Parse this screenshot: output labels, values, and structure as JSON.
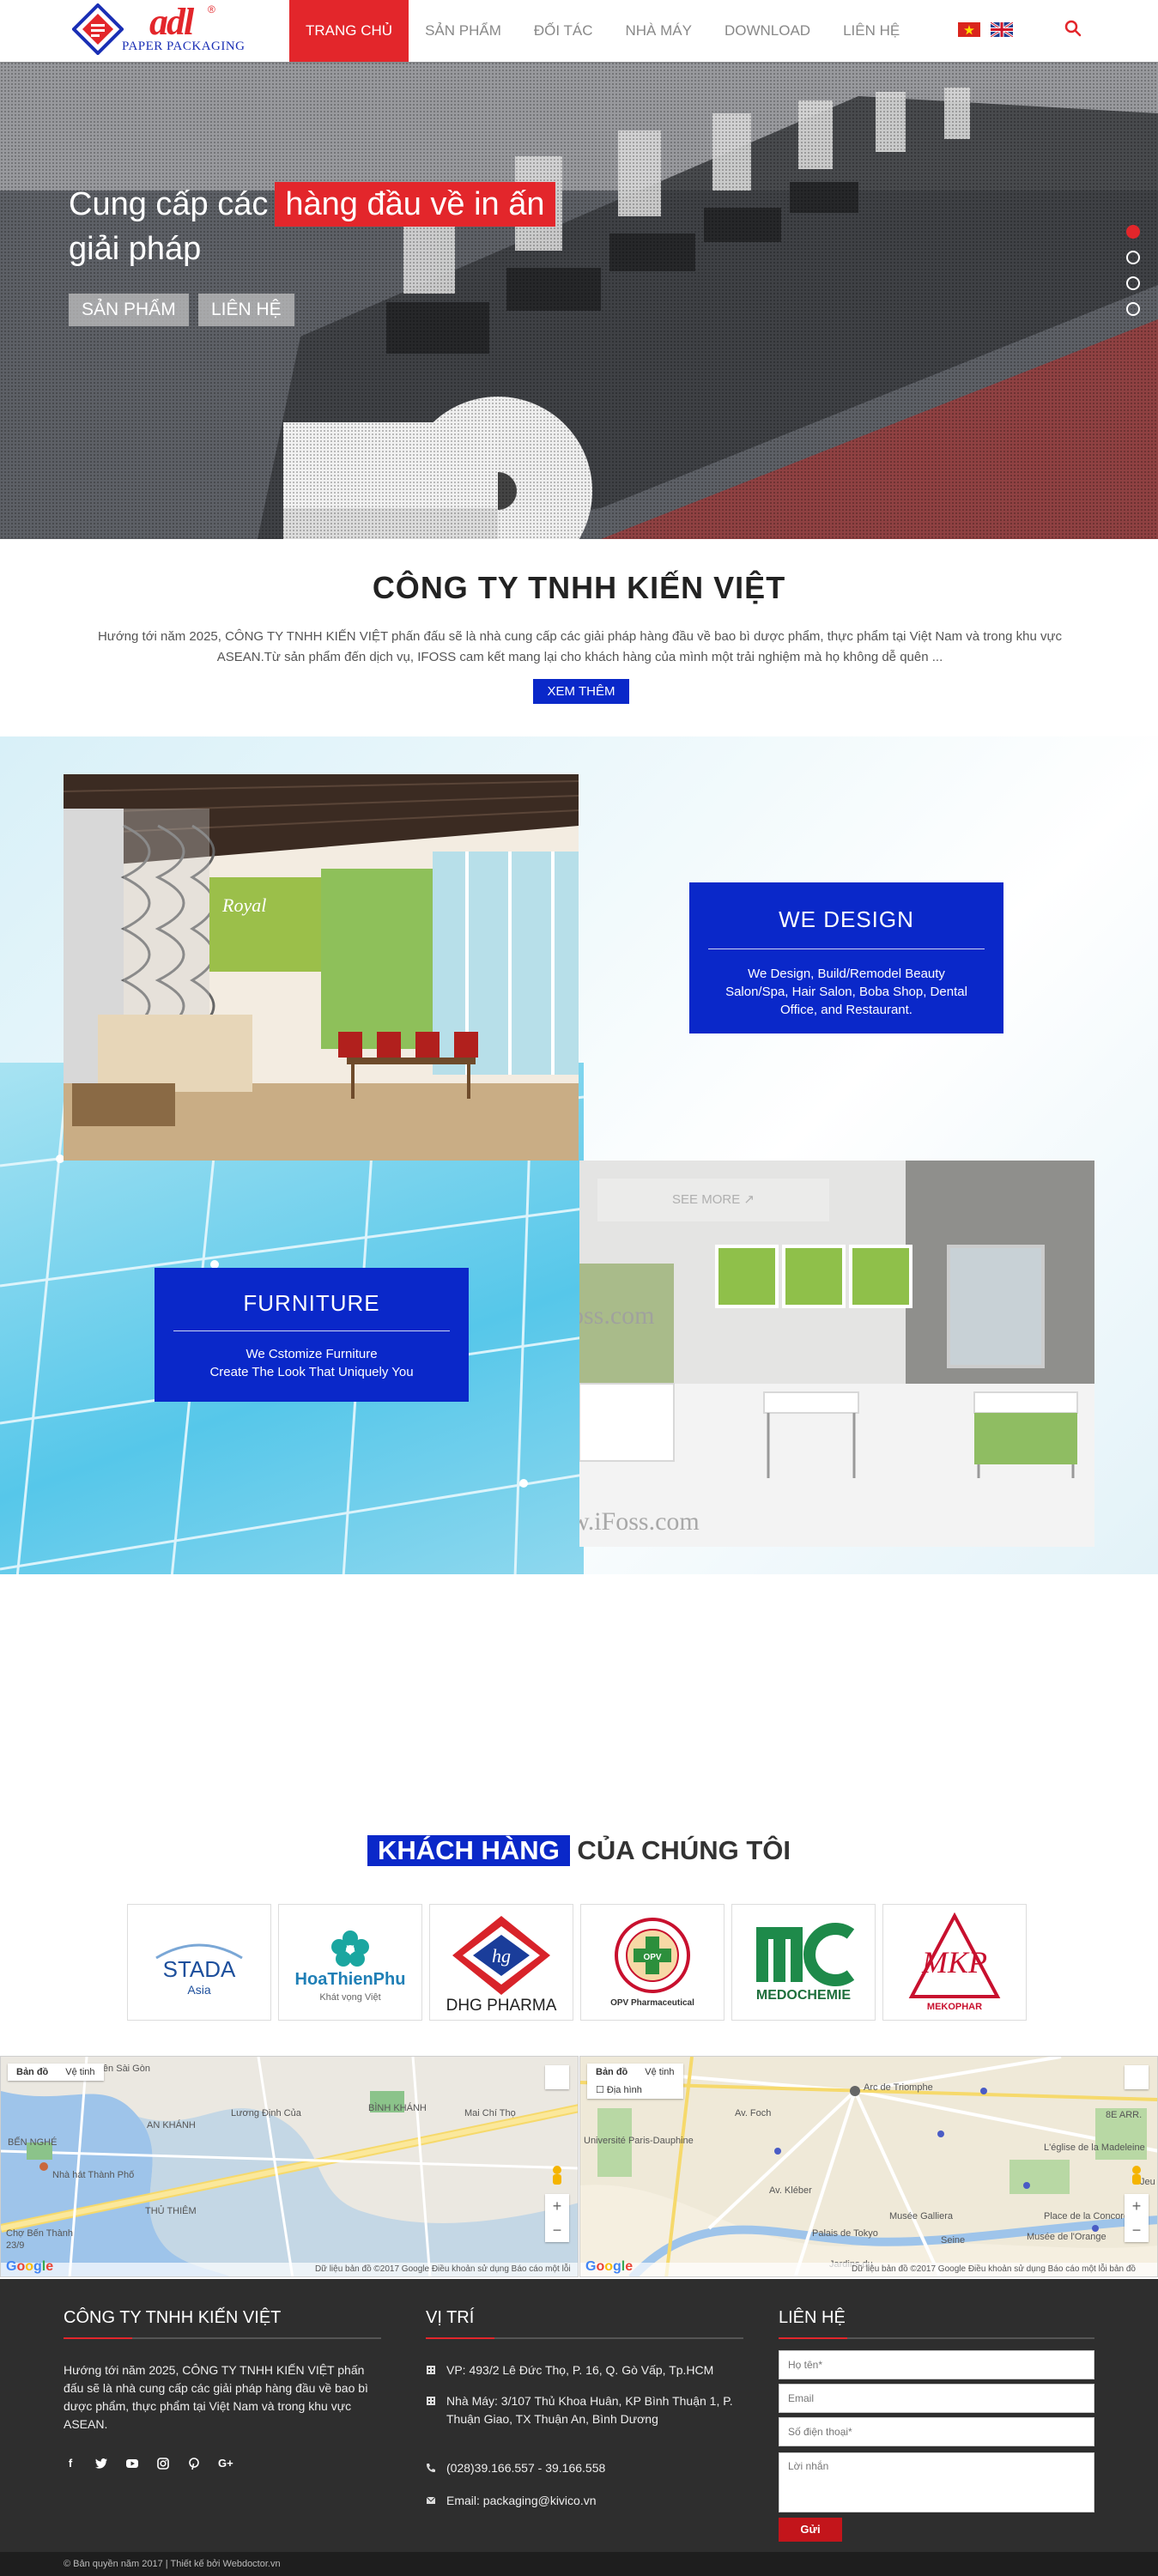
{
  "header": {
    "logo_text": "PAPER PACKAGING",
    "logo_mark": "adl",
    "nav": [
      {
        "label": "TRANG CHỦ",
        "active": true
      },
      {
        "label": "SẢN PHẨM",
        "active": false
      },
      {
        "label": "ĐỐI TÁC",
        "active": false
      },
      {
        "label": "NHÀ MÁY",
        "active": false
      },
      {
        "label": "DOWNLOAD",
        "active": false
      },
      {
        "label": "LIÊN HỆ",
        "active": false
      }
    ],
    "flags": [
      "vn-flag-icon",
      "uk-flag-icon"
    ],
    "accent_color": "#e3262b"
  },
  "hero": {
    "line1_plain": "Cung cấp các",
    "line1_highlight": "hàng đầu về in ấn",
    "line2": "giải pháp",
    "button_products": "SẢN PHẨM",
    "button_contact": "LIÊN HỆ",
    "slide_count": 4,
    "active_slide": 1
  },
  "company": {
    "title": "CÔNG TY TNHH KIẾN VIỆT",
    "description": "Hướng tới năm 2025, CÔNG TY TNHH KIẾN VIỆT phấn đấu sẽ là nhà cung cấp các giải pháp hàng đầu về bao bì dược phẩm, thực phẩm tại Việt Nam và trong khu vực ASEAN.Từ sản phẩm đến dịch vụ, IFOSS cam kết mang lại cho khách hàng của mình một trải nghiệm mà họ không dễ quên ...",
    "more_button": "XEM THÊM",
    "brand_color": "#0a28c9"
  },
  "design": {
    "card1": {
      "title": "WE DESIGN",
      "text": "We Design, Build/Remodel Beauty Salon/Spa, Hair Salon, Boba Shop, Dental Office, and Restaurant."
    },
    "card2": {
      "title": "FURNITURE",
      "text_line1": "We Cstomize Furniture",
      "text_line2": "Create The Look That Uniquely You"
    },
    "see_more": "SEE MORE",
    "shop_sign": "Royal",
    "watermark1": "oss.com",
    "watermark2": "w.iFoss.com"
  },
  "customers": {
    "title_highlight": "KHÁCH HÀNG",
    "title_rest": " CỦA CHÚNG TÔI",
    "logos": [
      {
        "name": "stada-logo",
        "line1": "STADA",
        "line2": "Asia"
      },
      {
        "name": "hoathienphu-logo",
        "line1": "HoaThienPhu",
        "line2": "Khát vọng Việt"
      },
      {
        "name": "dhg-pharma-logo",
        "line1": "DHG PHARMA",
        "line2": ""
      },
      {
        "name": "opv-logo",
        "line1": "OPV Pharmaceutical",
        "line2": "OPV"
      },
      {
        "name": "medochemie-logo",
        "line1": "MEDOCHEMIE",
        "line2": "MC"
      },
      {
        "name": "mekophar-logo",
        "line1": "MEKOPHAR",
        "line2": "MKP"
      }
    ]
  },
  "maps": {
    "tab_map": "Bản đồ",
    "tab_satellite": "Vệ tinh",
    "map1": {
      "footer": "Dữ liệu bản đồ ©2017 Google   Điều khoản sử dụng   Báo cáo một lỗi bản đồ",
      "labels": [
        "Cảng Viên Sài Gòn",
        "BẾN NGHÉ",
        "AN KHÁNH",
        "BÌNH KHÁNH",
        "Nhà hát Thành Phố",
        "THỦ THIÊM",
        "Chợ Bến Thành",
        "Mai Chí Thọ",
        "Lương Định Của",
        "23/9"
      ]
    },
    "map2": {
      "terrain_label": "Địa hình",
      "footer": "Dữ liệu bản đồ ©2017 Google   Điều khoản sử dụng   Báo cáo một lỗi bản đồ",
      "labels": [
        "Arc de Triomphe",
        "8E ARR.",
        "L'église de la Madeleine",
        "Place de la Concorde",
        "Palais de Tokyo",
        "Musée Galliera",
        "Musée de l'Orange",
        "Seine",
        "Université Paris-Dauphine",
        "Jardins du",
        "Av. Foch",
        "Av. Kléber",
        "Jeu d"
      ]
    }
  },
  "footer": {
    "col1_title": "CÔNG TY TNHH KIẾN VIỆT",
    "col1_text": "Hướng tới năm 2025, CÔNG TY TNHH KIẾN VIỆT phấn đấu sẽ là nhà cung cấp các giải pháp hàng đầu về bao bì dược phẩm, thực phẩm tại Việt Nam và trong khu vực ASEAN.",
    "social": [
      "facebook-icon",
      "twitter-icon",
      "youtube-icon",
      "instagram-icon",
      "pinterest-icon",
      "google-plus-icon"
    ],
    "col2_title": "VỊ TRÍ",
    "office": "VP: 493/2 Lê Đức Thọ, P. 16, Q. Gò Vấp, Tp.HCM",
    "factory": "Nhà Máy: 3/107 Thủ Khoa Huân, KP Bình Thuận 1, P. Thuận Giao, TX Thuận An, Bình Dương",
    "phone": "(028)39.166.557 - 39.166.558",
    "email": "Email: packaging@kivico.vn",
    "col3_title": "LIÊN HỆ",
    "placeholder_name": "Họ tên*",
    "placeholder_email": "Email",
    "placeholder_phone": "Số điện thoại*",
    "placeholder_message": "Lời nhắn",
    "send_button": "Gửi",
    "copyright": "© Bản quyền năm 2017 | Thiết kế bởi Webdoctor.vn"
  }
}
